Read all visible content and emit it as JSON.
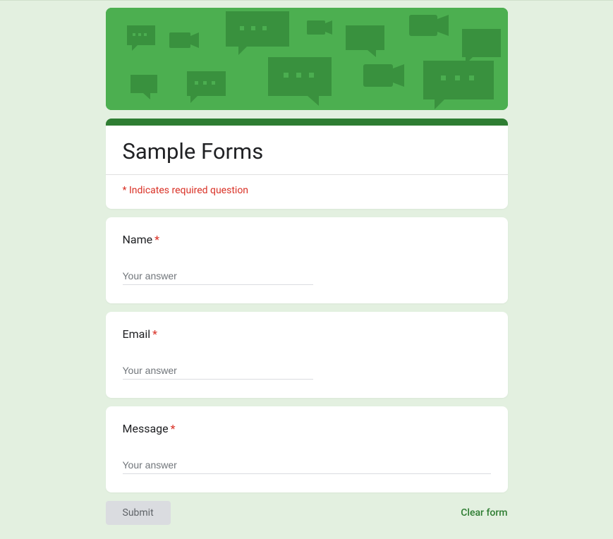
{
  "form": {
    "title": "Sample Forms",
    "required_notice": "* Indicates required question"
  },
  "questions": {
    "name": {
      "label": "Name",
      "placeholder": "Your answer"
    },
    "email": {
      "label": "Email",
      "placeholder": "Your answer"
    },
    "message": {
      "label": "Message",
      "placeholder": "Your answer"
    }
  },
  "actions": {
    "submit_label": "Submit",
    "clear_label": "Clear form"
  },
  "required_symbol": "*"
}
